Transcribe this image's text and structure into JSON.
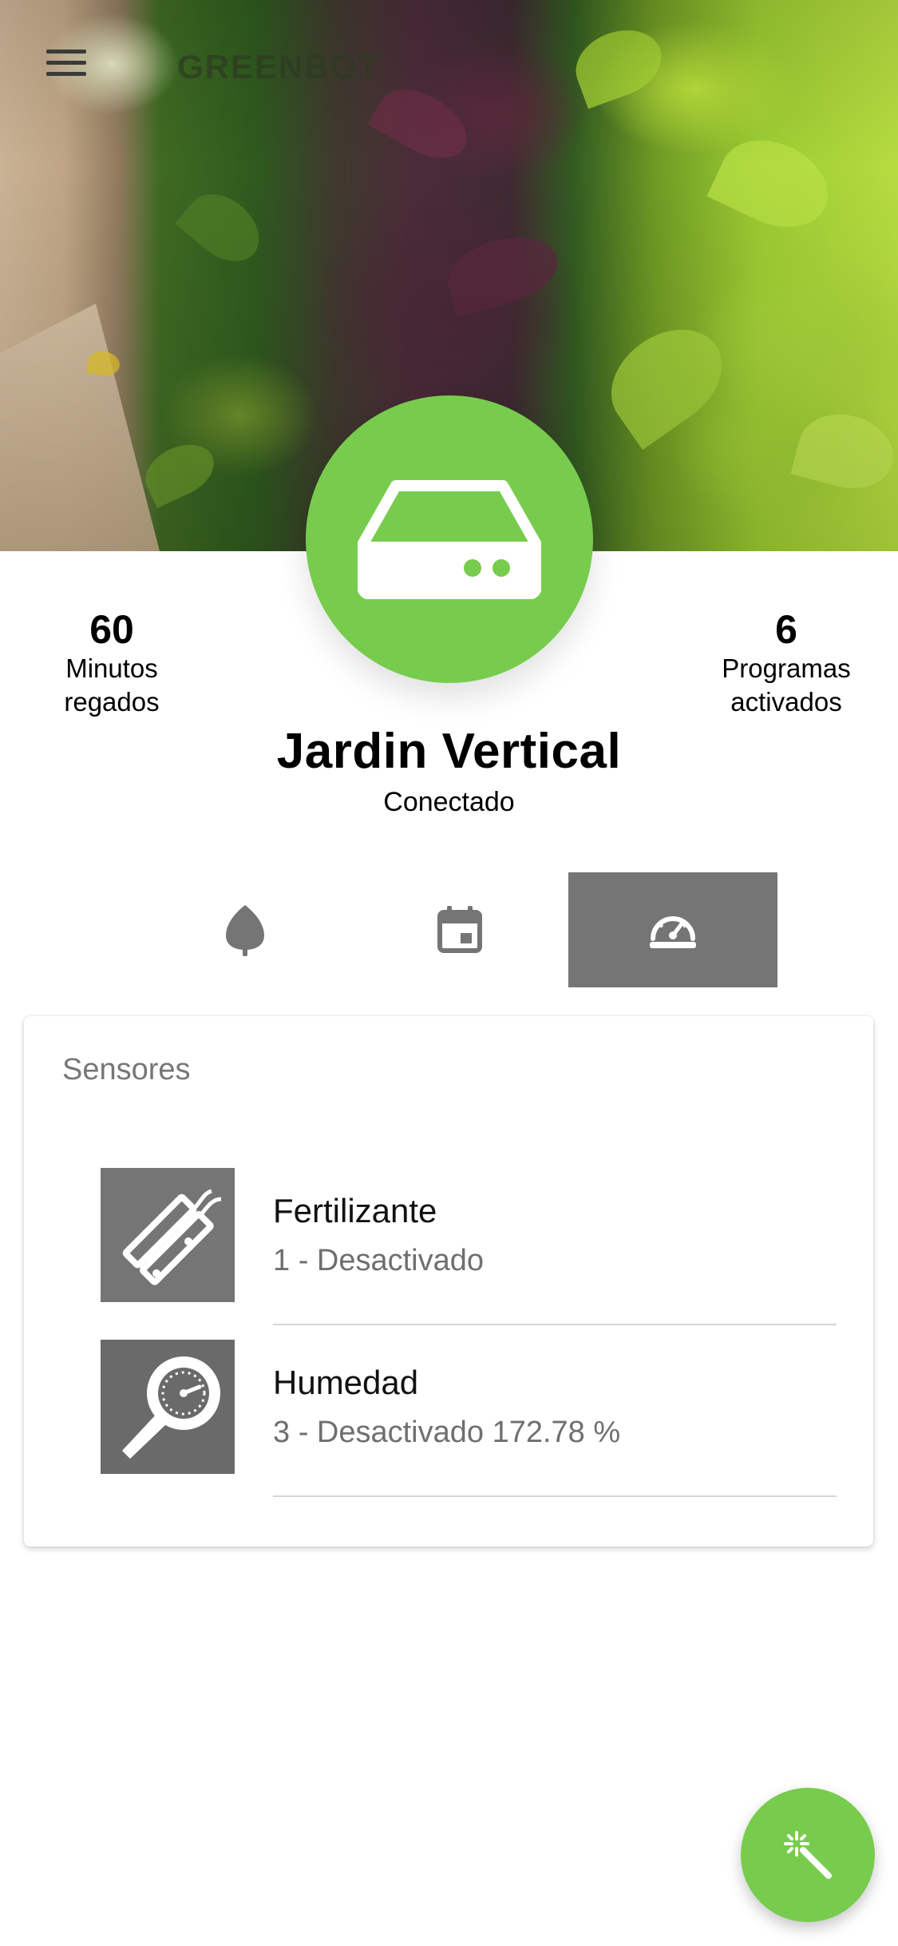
{
  "header": {
    "brand": "GREENBOT",
    "menu_icon": "hamburger-menu-icon",
    "background": "vertical-garden-photo"
  },
  "device": {
    "icon": "server-drive-icon",
    "name": "Jardin Vertical",
    "status": "Conectado",
    "accent_color": "#77cc4d"
  },
  "stats": {
    "left": {
      "value": "60",
      "label_line1": "Minutos",
      "label_line2": "regados"
    },
    "right": {
      "value": "6",
      "label_line1": "Programas",
      "label_line2": "activados"
    }
  },
  "tabs": [
    {
      "icon": "drop-leaf-icon",
      "active": false
    },
    {
      "icon": "calendar-icon",
      "active": false
    },
    {
      "icon": "speedometer-icon",
      "active": true
    }
  ],
  "sensors_card": {
    "title": "Sensores",
    "items": [
      {
        "icon": "fertilizer-sensor-icon",
        "name": "Fertilizante",
        "detail": "1 - Desactivado"
      },
      {
        "icon": "humidity-probe-icon",
        "name": "Humedad",
        "detail": "3 - Desactivado 172.78 %"
      }
    ]
  },
  "fab": {
    "icon": "magic-wand-icon"
  }
}
